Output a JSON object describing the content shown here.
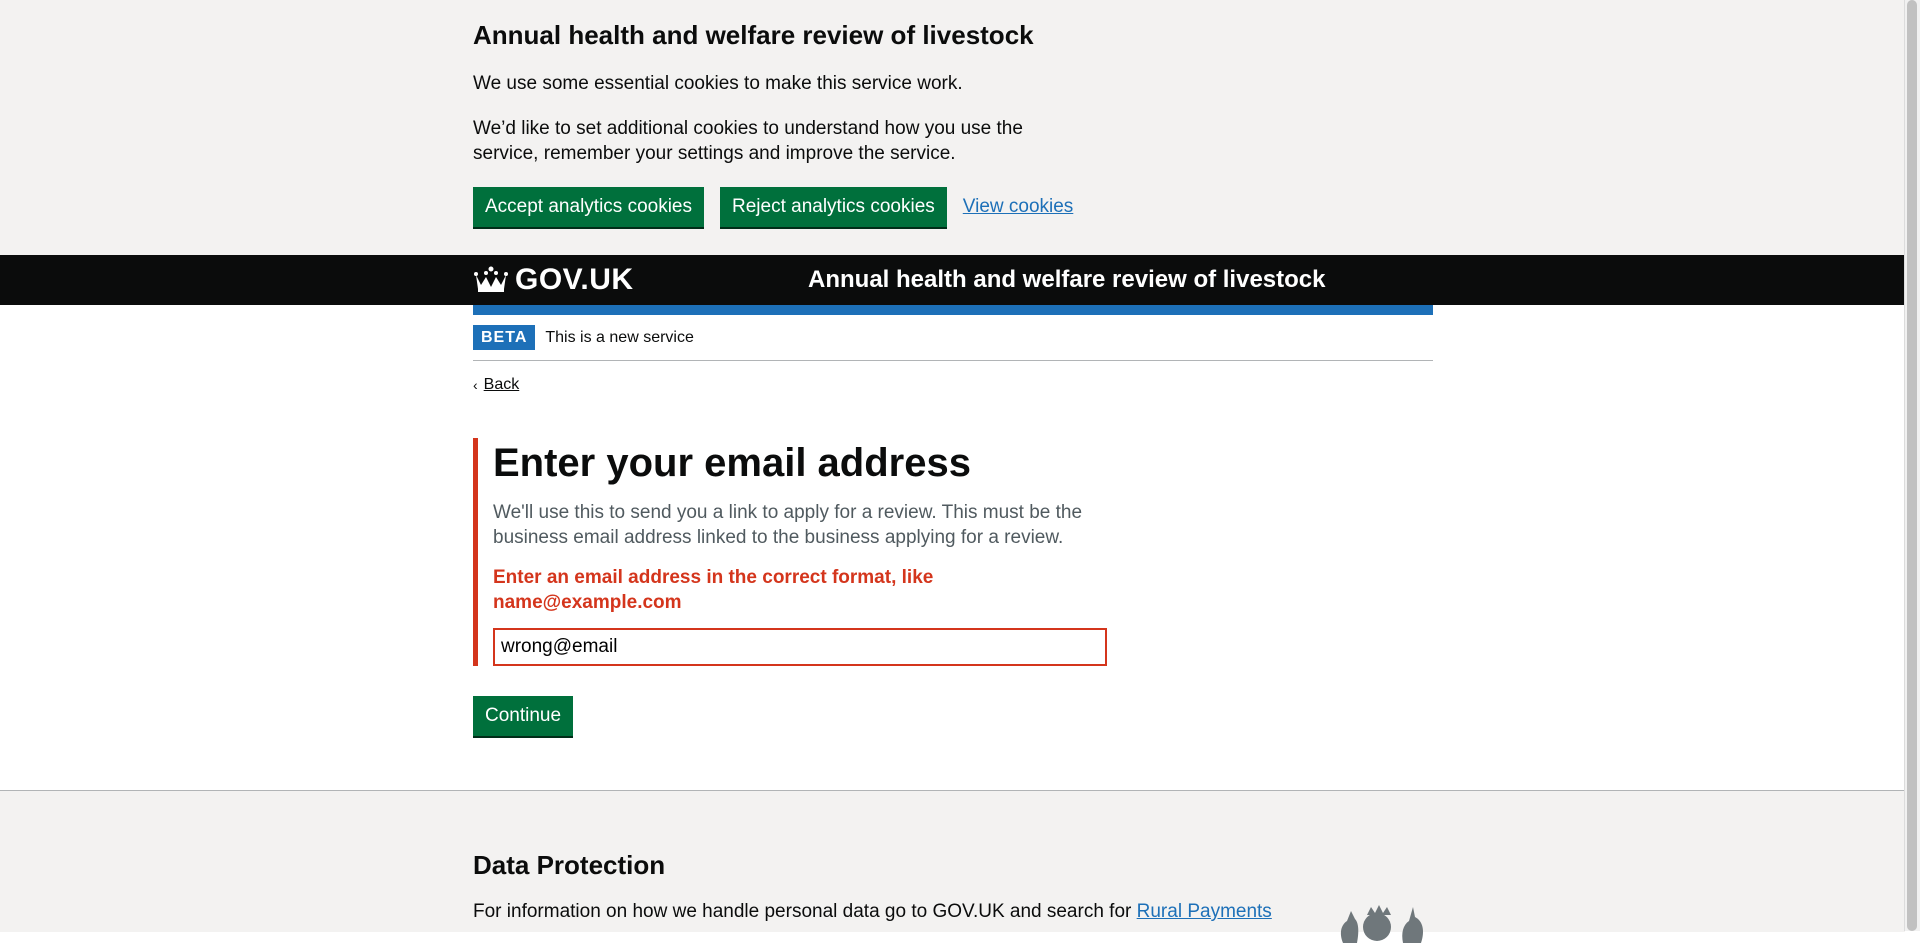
{
  "cookie_banner": {
    "title": "Annual health and welfare review of livestock",
    "p1": "We use some essential cookies to make this service work.",
    "p2": "We’d like to set additional cookies to understand how you use the service, remember your settings and improve the service.",
    "accept_label": "Accept analytics cookies",
    "reject_label": "Reject analytics cookies",
    "view_label": "View cookies"
  },
  "header": {
    "logo_text": "GOV.UK",
    "service_name": "Annual health and welfare review of livestock"
  },
  "phase_banner": {
    "tag": "BETA",
    "text": "This is a new service"
  },
  "back_link": "Back",
  "form": {
    "heading": "Enter your email address",
    "hint": "We'll use this to send you a link to apply for a review. This must be the business email address linked to the business applying for a review.",
    "error": "Enter an email address in the correct format, like name@example.com",
    "email_value": "wrong@email",
    "continue_label": "Continue"
  },
  "footer": {
    "title": "Data Protection",
    "text_prefix": "For information on how we handle personal data go to GOV.UK and search for ",
    "text_link": "Rural Payments"
  },
  "colors": {
    "brand_green": "#00703c",
    "link_blue": "#1d70b8",
    "error_red": "#d4351c",
    "header_black": "#0b0c0c"
  }
}
